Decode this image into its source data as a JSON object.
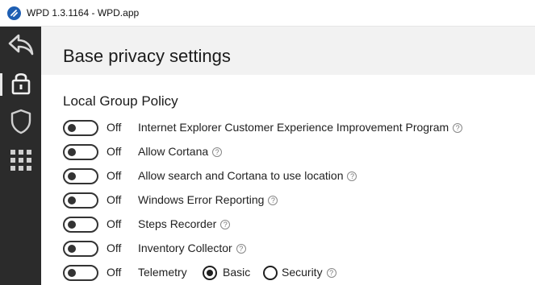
{
  "window": {
    "title": "WPD 1.3.1164 - WPD.app"
  },
  "sidebar": {
    "items": [
      {
        "icon": "back-arrow-icon"
      },
      {
        "icon": "lock-icon",
        "active": true
      },
      {
        "icon": "shield-icon"
      },
      {
        "icon": "apps-grid-icon"
      }
    ]
  },
  "header": {
    "title": "Base privacy settings"
  },
  "section": {
    "title": "Local Group Policy",
    "items": [
      {
        "state": "Off",
        "label": "Internet Explorer Customer Experience Improvement Program",
        "help": "?"
      },
      {
        "state": "Off",
        "label": "Allow Cortana",
        "help": "?"
      },
      {
        "state": "Off",
        "label": "Allow search and Cortana to use location",
        "help": "?"
      },
      {
        "state": "Off",
        "label": "Windows Error Reporting",
        "help": "?"
      },
      {
        "state": "Off",
        "label": "Steps Recorder",
        "help": "?"
      },
      {
        "state": "Off",
        "label": "Inventory Collector",
        "help": "?"
      },
      {
        "state": "Off",
        "label": "Telemetry",
        "help": "?"
      }
    ],
    "telemetry_options": [
      {
        "label": "Basic",
        "selected": true
      },
      {
        "label": "Security",
        "selected": false
      }
    ]
  }
}
